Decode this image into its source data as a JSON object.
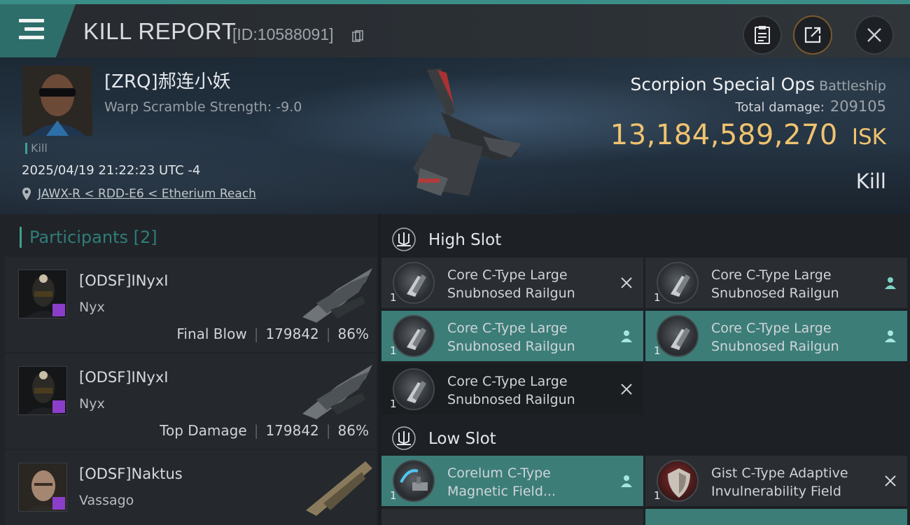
{
  "header": {
    "title": "KILL REPORT",
    "report_id": "[ID:10588091]"
  },
  "victim": {
    "name": "[ZRQ]郝连小妖",
    "warp_scramble": "Warp Scramble Strength: -9.0",
    "event_type": "Kill",
    "datetime": "2025/04/19 21:22:23 UTC -4",
    "location": "JAWX-R < RDD-E6 < Etherium Reach",
    "ship_name": "Scorpion Special Ops",
    "ship_class": "Battleship",
    "total_damage_label": "Total damage:",
    "total_damage": "209105",
    "isk_value": "13,184,589,270",
    "isk_unit": "ISK",
    "result": "Kill"
  },
  "participants": {
    "title": "Participants [2]",
    "rows": [
      {
        "name": "[ODSF]INyxI",
        "ship": "Nyx",
        "role": "Final Blow",
        "damage": "179842",
        "percent": "86%"
      },
      {
        "name": "[ODSF]INyxI",
        "ship": "Nyx",
        "role": "Top Damage",
        "damage": "179842",
        "percent": "86%"
      },
      {
        "name": "[ODSF]Naktus",
        "ship": "Vassago",
        "role": "",
        "damage": "",
        "percent": ""
      }
    ]
  },
  "high_slot": {
    "title": "High Slot",
    "modules": [
      {
        "name": "Core C-Type Large Snubnosed Railgun",
        "qty": "1",
        "status": "destroyed"
      },
      {
        "name": "Core C-Type Large Snubnosed Railgun",
        "qty": "1",
        "status": "dropped"
      },
      {
        "name": "Core C-Type Large Snubnosed Railgun",
        "qty": "1",
        "status": "dropped"
      },
      {
        "name": "Core C-Type Large Snubnosed Railgun",
        "qty": "1",
        "status": "dropped"
      },
      {
        "name": "Core C-Type Large Snubnosed Railgun",
        "qty": "1",
        "status": "destroyed"
      }
    ]
  },
  "low_slot": {
    "title": "Low Slot",
    "modules": [
      {
        "name": "Corelum C-Type Magnetic Field...",
        "qty": "1",
        "status": "dropped"
      },
      {
        "name": "Gist C-Type Adaptive Invulnerability Field",
        "qty": "1",
        "status": "destroyed"
      }
    ]
  },
  "colors": {
    "accent_teal": "#3c7d78",
    "isk_gold": "#efc36f",
    "badge_purple": "#8b3ec9"
  },
  "icons": {
    "menu": "hamburger-menu-icon",
    "copy": "copy-icon",
    "clipboard": "clipboard-icon",
    "share": "share-icon",
    "close": "close-icon",
    "location": "location-pin-icon",
    "slot": "slot-module-icon",
    "destroyed": "x-mark-icon",
    "dropped": "person-icon"
  }
}
